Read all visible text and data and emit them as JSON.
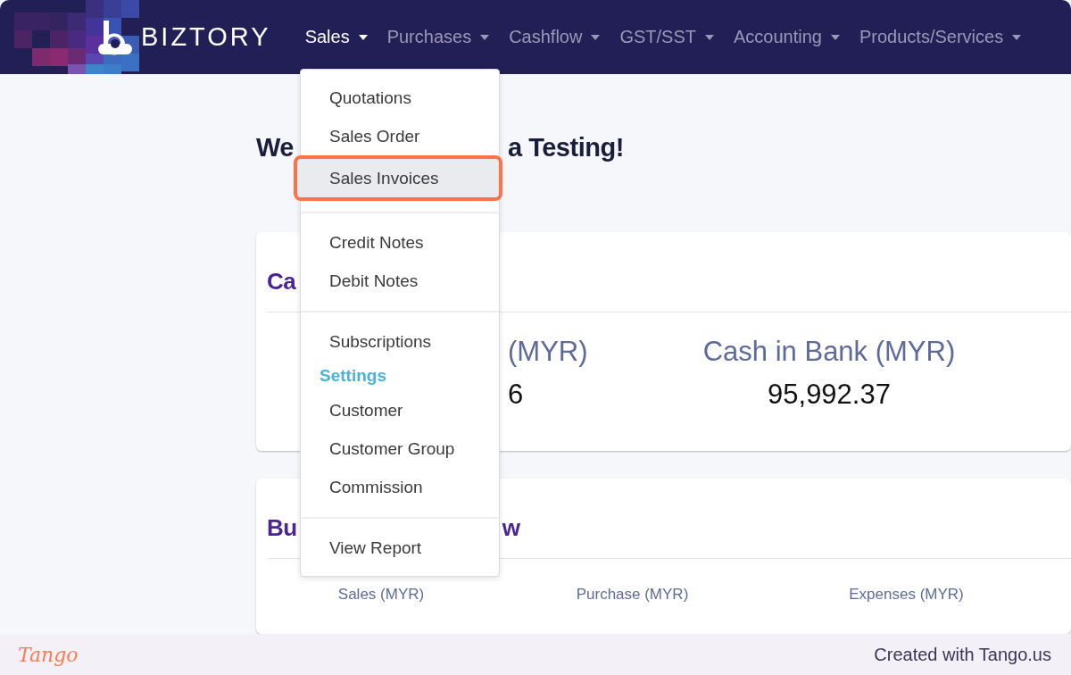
{
  "navbar": {
    "brand": "BIZTORY",
    "menus": [
      {
        "label": "Sales",
        "selected": true
      },
      {
        "label": "Purchases",
        "selected": false
      },
      {
        "label": "Cashflow",
        "selected": false
      },
      {
        "label": "GST/SST",
        "selected": false
      },
      {
        "label": "Accounting",
        "selected": false
      },
      {
        "label": "Products/Services",
        "selected": false
      }
    ]
  },
  "welcome": {
    "heading_start": "We",
    "heading_end": "a Testing!"
  },
  "cash_card": {
    "title": "Ca",
    "stats": [
      {
        "label": "(MYR)",
        "value": "6"
      },
      {
        "label": "Cash in Bank (MYR)",
        "value": "95,992.37"
      }
    ]
  },
  "business_card": {
    "title_start": "Bu",
    "title_end": "w",
    "columns": [
      "Sales (MYR)",
      "Purchase (MYR)",
      "Expenses (MYR)"
    ]
  },
  "sales_menu": {
    "items": [
      {
        "kind": "item",
        "label": "Quotations",
        "selected": false
      },
      {
        "kind": "item",
        "label": "Sales Order",
        "selected": false
      },
      {
        "kind": "item",
        "label": "Sales Invoices",
        "selected": true
      },
      {
        "kind": "divider"
      },
      {
        "kind": "item",
        "label": "Credit Notes",
        "selected": false
      },
      {
        "kind": "item",
        "label": "Debit Notes",
        "selected": false
      },
      {
        "kind": "divider"
      },
      {
        "kind": "item",
        "label": "Subscriptions",
        "selected": false
      },
      {
        "kind": "header",
        "label": "Settings"
      },
      {
        "kind": "item",
        "label": "Customer",
        "selected": false
      },
      {
        "kind": "item",
        "label": "Customer Group",
        "selected": false
      },
      {
        "kind": "item",
        "label": "Commission",
        "selected": false
      },
      {
        "kind": "divider"
      },
      {
        "kind": "item",
        "label": "View Report",
        "selected": false
      }
    ]
  },
  "footer": {
    "brand": "Tango",
    "credit": "Created with Tango.us"
  }
}
